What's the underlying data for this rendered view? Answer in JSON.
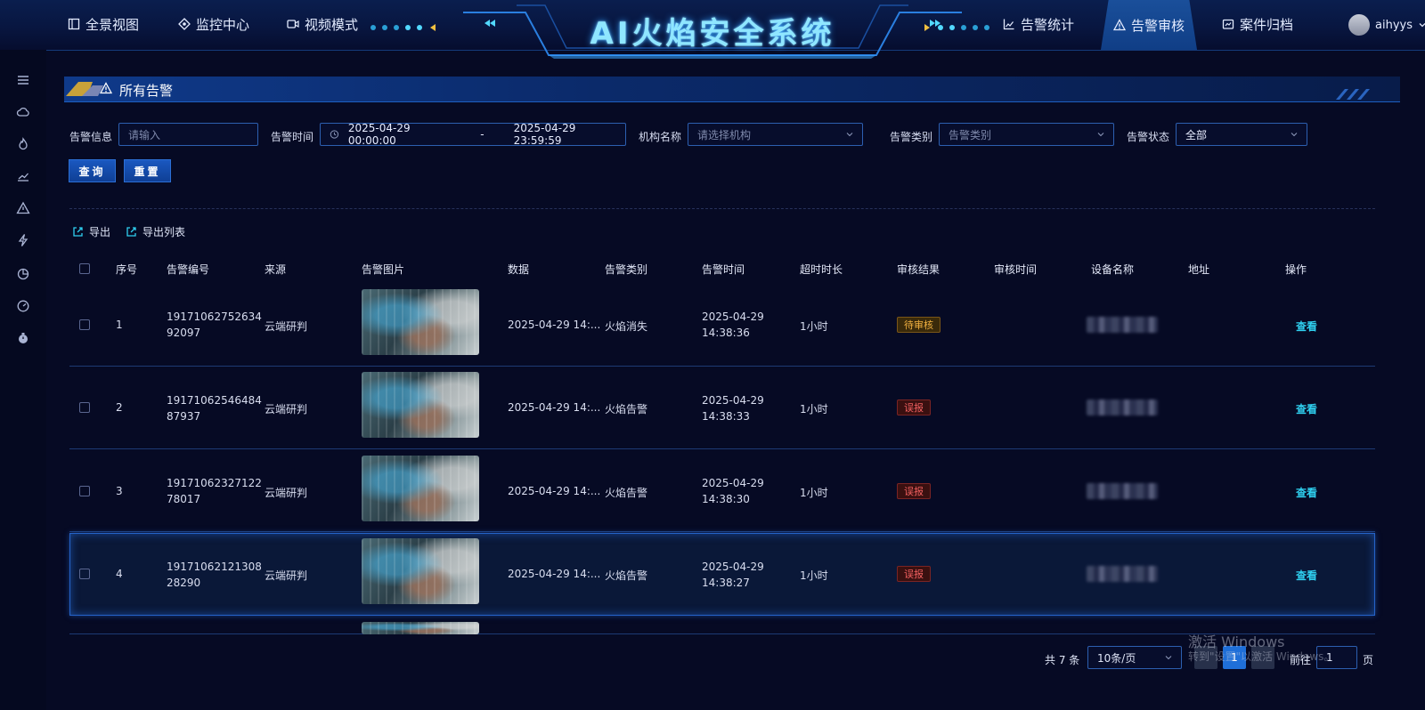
{
  "header": {
    "title": "AI火焰安全系统",
    "nav_left": [
      "全景视图",
      "监控中心",
      "视频模式"
    ],
    "nav_right": [
      "告警统计",
      "告警审核",
      "案件归档"
    ],
    "username": "aihyys"
  },
  "section": {
    "title": "所有告警"
  },
  "filters": {
    "info_label": "告警信息",
    "info_placeholder": "请输入",
    "time_label": "告警时间",
    "time_start": "2025-04-29 00:00:00",
    "time_sep": "-",
    "time_end": "2025-04-29 23:59:59",
    "org_label": "机构名称",
    "org_placeholder": "请选择机构",
    "type_label": "告警类别",
    "type_placeholder": "告警类别",
    "status_label": "告警状态",
    "status_value": "全部",
    "query_button": "查询",
    "reset_button": "重置"
  },
  "toolbar": {
    "export": "导出",
    "export_list": "导出列表"
  },
  "table": {
    "columns": [
      "序号",
      "告警编号",
      "来源",
      "告警图片",
      "数据",
      "告警类别",
      "告警时间",
      "超时时长",
      "审核结果",
      "审核时间",
      "设备名称",
      "地址",
      "操作"
    ],
    "rows": [
      {
        "index": "1",
        "code_a": "19171062752634",
        "code_b": "92097",
        "source": "云端研判",
        "data": "2025-04-29 14:...",
        "type": "火焰消失",
        "date": "2025-04-29",
        "time": "14:38:36",
        "timeout": "1小时",
        "result": "待审核",
        "action": "查看"
      },
      {
        "index": "2",
        "code_a": "19171062546484",
        "code_b": "87937",
        "source": "云端研判",
        "data": "2025-04-29 14:...",
        "type": "火焰告警",
        "date": "2025-04-29",
        "time": "14:38:33",
        "timeout": "1小时",
        "result": "误报",
        "action": "查看"
      },
      {
        "index": "3",
        "code_a": "19171062327122",
        "code_b": "78017",
        "source": "云端研判",
        "data": "2025-04-29 14:...",
        "type": "火焰告警",
        "date": "2025-04-29",
        "time": "14:38:30",
        "timeout": "1小时",
        "result": "误报",
        "action": "查看"
      },
      {
        "index": "4",
        "code_a": "19171062121308",
        "code_b": "28290",
        "source": "云端研判",
        "data": "2025-04-29 14:...",
        "type": "火焰告警",
        "date": "2025-04-29",
        "time": "14:38:27",
        "timeout": "1小时",
        "result": "误报",
        "action": "查看"
      }
    ]
  },
  "pagination": {
    "total": "共 7 条",
    "page_size": "10条/页",
    "goto_label": "前往",
    "goto_value": "1",
    "page_unit": "页",
    "current_page": "1"
  },
  "watermark": {
    "line1": "激活 Windows",
    "line2": "转到\"设置\"以激活 Windows。"
  },
  "colors": {
    "accent": "#2fd0f0",
    "pending": "#f0b040",
    "false_alarm": "#f26060"
  }
}
